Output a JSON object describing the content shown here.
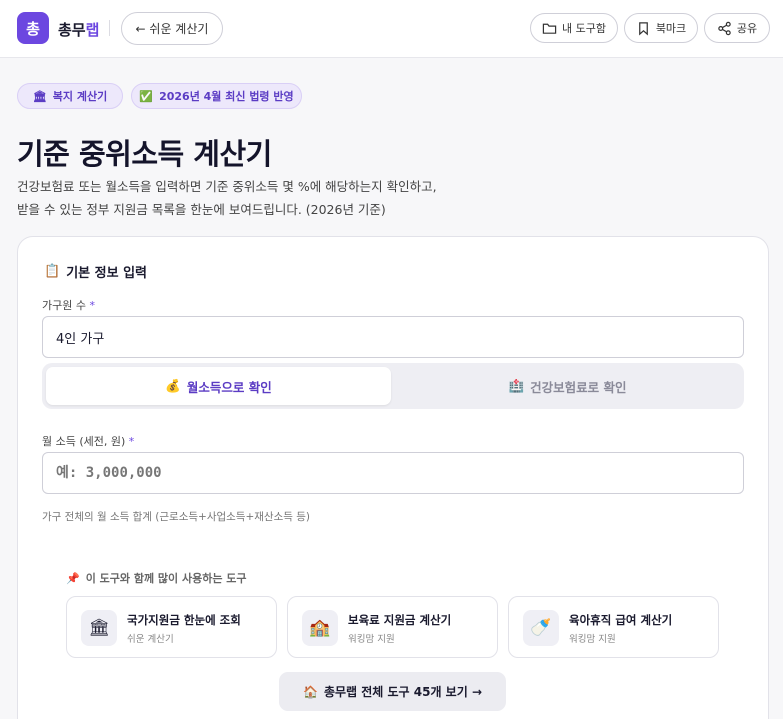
{
  "header": {
    "logo_char": "총",
    "brand_main": "총무",
    "brand_accent": "랩",
    "back_label": "← 쉬운 계산기",
    "toolbox_label": "내 도구함",
    "bookmark_label": "북마크",
    "share_label": "공유"
  },
  "badges": [
    {
      "icon": "🏛",
      "label": "복지 계산기"
    },
    {
      "icon": "✅",
      "label": "2026년 4월 최신 법령 반영"
    }
  ],
  "page": {
    "title": "기준 중위소득 계산기",
    "desc_line1": "건강보험료 또는 월소득을 입력하면 기준 중위소득 몇 %에 해당하는지 확인하고,",
    "desc_line2": "받을 수 있는 정부 지원금 목록을 한눈에 보여드립니다. (2026년 기준)"
  },
  "form": {
    "section_icon": "📋",
    "section_title": "기본 정보 입력",
    "household_label": "가구원 수",
    "required_mark": "*",
    "household_value": "4인 가구",
    "toggle": [
      {
        "icon": "💰",
        "label": "월소득으로 확인",
        "active": true
      },
      {
        "icon": "🏥",
        "label": "건강보험료로 확인",
        "active": false
      }
    ],
    "income_label": "월 소득 (세전, 원)",
    "income_placeholder": "예: 3,000,000",
    "income_value": "",
    "income_hint": "가구 전체의 월 소득 합계 (근로소득+사업소득+재산소득 등)"
  },
  "related": {
    "icon": "📌",
    "title": "이 도구와 함께 많이 사용하는 도구",
    "tools": [
      {
        "icon": "🏛",
        "name": "국가지원금 한눈에 조회",
        "sub": "쉬운 계산기"
      },
      {
        "icon": "🏫",
        "name": "보육료 지원금 계산기",
        "sub": "워킹맘 지원"
      },
      {
        "icon": "🍼",
        "name": "육아휴직 급여 계산기",
        "sub": "워킹맘 지원"
      }
    ],
    "all_icon": "🏠",
    "all_label": "총무랩 전체 도구 45개 보기 →"
  }
}
